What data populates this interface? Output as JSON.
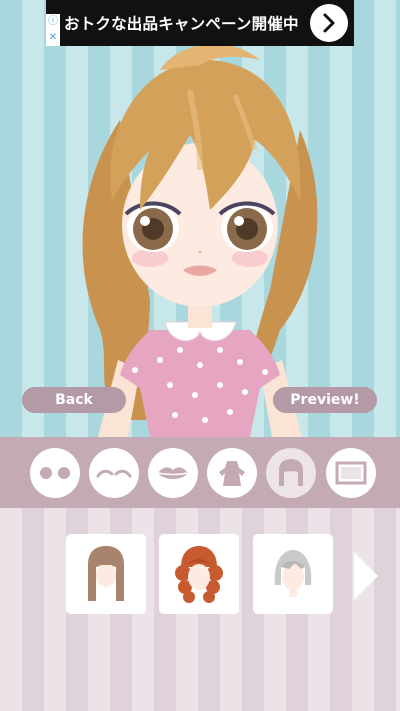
{
  "ad": {
    "text": "おトクな出品キャンペーン開催中",
    "info_icon": "info-icon",
    "close_icon": "close-icon",
    "go_icon": "chevron-right-icon"
  },
  "buttons": {
    "back": "Back",
    "preview": "Preview!"
  },
  "categories": [
    {
      "icon": "eyes-icon"
    },
    {
      "icon": "eyebrows-icon"
    },
    {
      "icon": "lips-icon"
    },
    {
      "icon": "dress-icon"
    },
    {
      "icon": "hair-icon",
      "selected": true
    },
    {
      "icon": "background-frame-icon"
    }
  ],
  "items": [
    {
      "icon": "brown-straight-hair-icon",
      "color": "#a8836d"
    },
    {
      "icon": "red-curly-hair-icon",
      "color": "#c85a30"
    },
    {
      "icon": "silver-short-hair-icon",
      "color": "#c9c9c9"
    }
  ],
  "colors": {
    "accent": "#b49aa6",
    "category_bar": "#c3aab5",
    "stage_stripe_dark": "#a9d7de",
    "stage_stripe_light": "#c7e7eb"
  }
}
